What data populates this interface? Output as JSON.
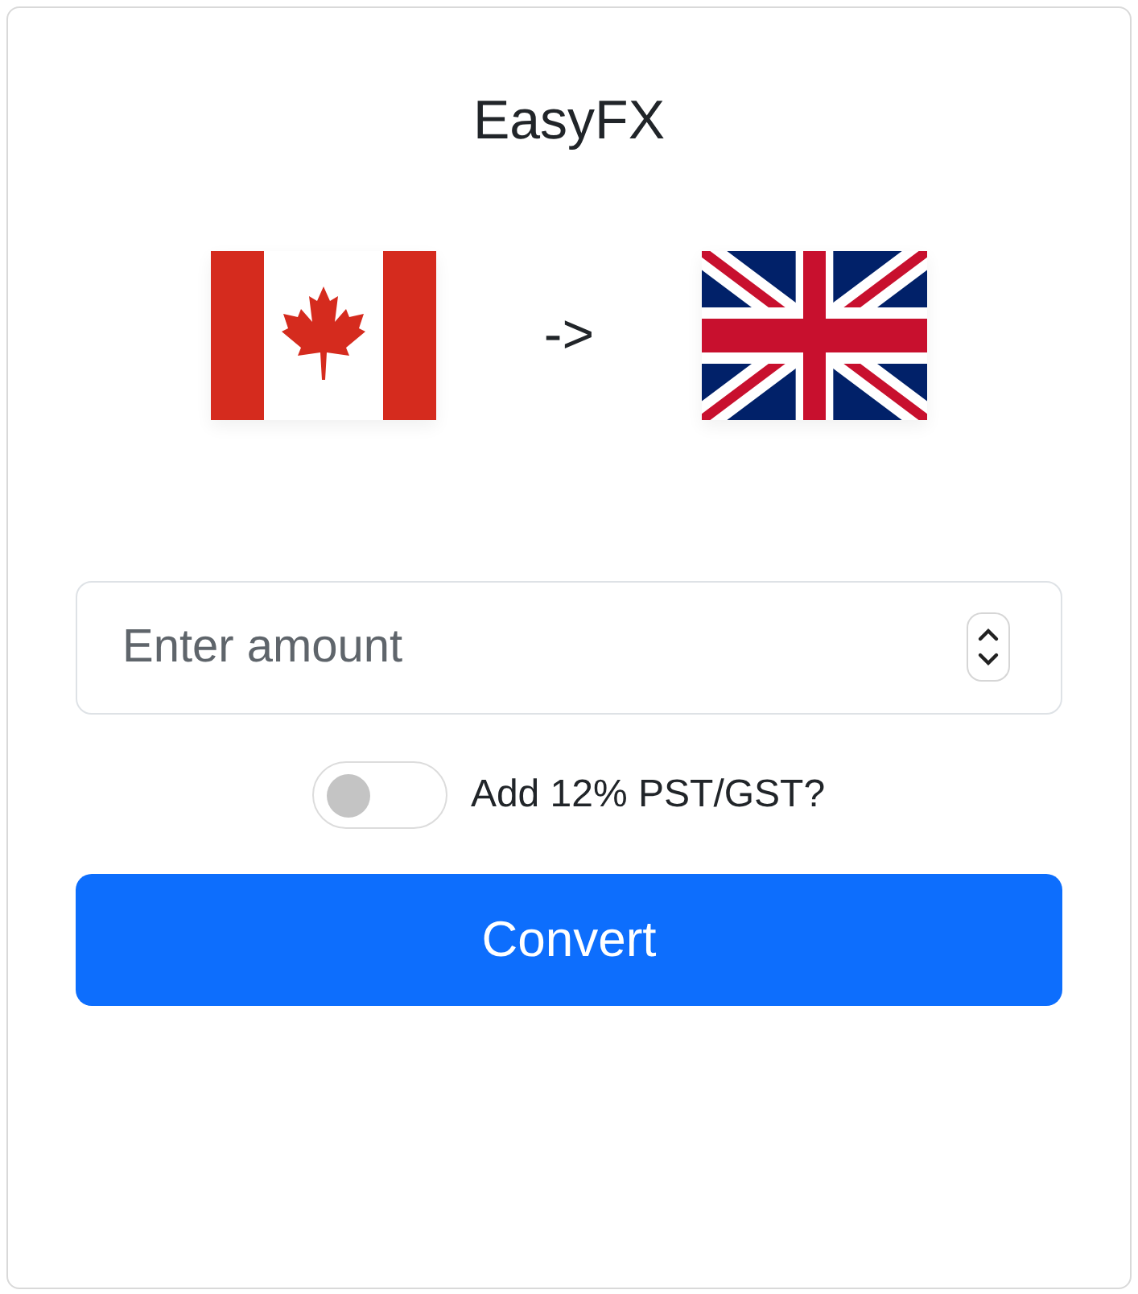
{
  "title": "EasyFX",
  "arrow": "->",
  "amount_field": {
    "placeholder": "Enter amount"
  },
  "tax_toggle": {
    "label": "Add 12% PST/GST?",
    "on": false
  },
  "convert_button": {
    "label": "Convert"
  }
}
